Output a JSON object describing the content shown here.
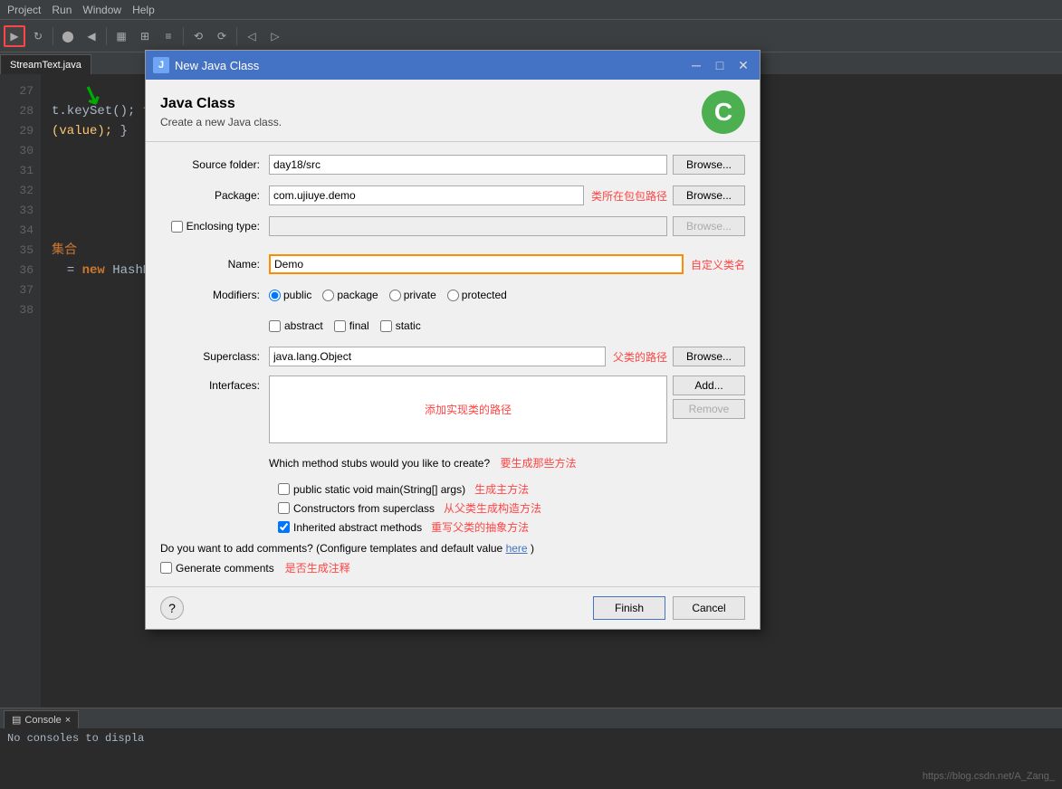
{
  "menu": {
    "items": [
      "Project",
      "Run",
      "Window",
      "Help"
    ]
  },
  "tabs": {
    "open": [
      "StreamText.java"
    ]
  },
  "code": {
    "lines": [
      {
        "num": "27",
        "content": ""
      },
      {
        "num": "28",
        "content": "t.keySet(); f"
      },
      {
        "num": "29",
        "content": "(value); }"
      },
      {
        "num": "30",
        "content": ""
      },
      {
        "num": "31",
        "content": ""
      },
      {
        "num": "32",
        "content": ""
      },
      {
        "num": "33",
        "content": ""
      },
      {
        "num": "34",
        "content": ""
      },
      {
        "num": "35",
        "content": "集合"
      },
      {
        "num": "36",
        "content": " = new HashMap"
      },
      {
        "num": "37",
        "content": ""
      },
      {
        "num": "38",
        "content": ""
      }
    ]
  },
  "dialog": {
    "title": "New Java Class",
    "header_title": "Java Class",
    "header_desc": "Create a new Java class.",
    "source_folder_label": "Source folder:",
    "source_folder_value": "day18/src",
    "package_label": "Package:",
    "package_value": "com.ujiuye.demo",
    "package_annotation": "类所在包包路径",
    "enclosing_label": "Enclosing type:",
    "enclosing_value": "",
    "name_label": "Name:",
    "name_value": "Demo",
    "name_annotation": "自定义类名",
    "modifiers_label": "Modifiers:",
    "modifier_public": "public",
    "modifier_package": "package",
    "modifier_private": "private",
    "modifier_protected": "protected",
    "mod_abstract": "abstract",
    "mod_final": "final",
    "mod_static": "static",
    "superclass_label": "Superclass:",
    "superclass_value": "java.lang.Object",
    "superclass_annotation": "父类的路径",
    "interfaces_label": "Interfaces:",
    "interfaces_placeholder": "添加实现类的路径",
    "stubs_label": "Which method stubs would you like to create?",
    "stubs_annotation": "要生成那些方法",
    "stub1_label": "public static void main(String[] args)",
    "stub1_annotation": "生成主方法",
    "stub2_label": "Constructors from superclass",
    "stub2_annotation": "从父类生成构造方法",
    "stub3_label": "Inherited abstract methods",
    "stub3_annotation": "重写父类的抽象方法",
    "comments_q": "Do you want to add comments? (Configure templates and default value",
    "comments_here": "here",
    "comments_end": ")",
    "generate_comments": "Generate comments",
    "generate_annotation": "是否生成注释",
    "browse_label": "Browse...",
    "add_label": "Add...",
    "remove_label": "Remove",
    "finish_label": "Finish",
    "cancel_label": "Cancel",
    "help_label": "?"
  },
  "bottom": {
    "tab_label": "Console",
    "tab_close": "×",
    "console_text": "No consoles to displa"
  },
  "watermark": "https://blog.csdn.net/A_Zang_"
}
